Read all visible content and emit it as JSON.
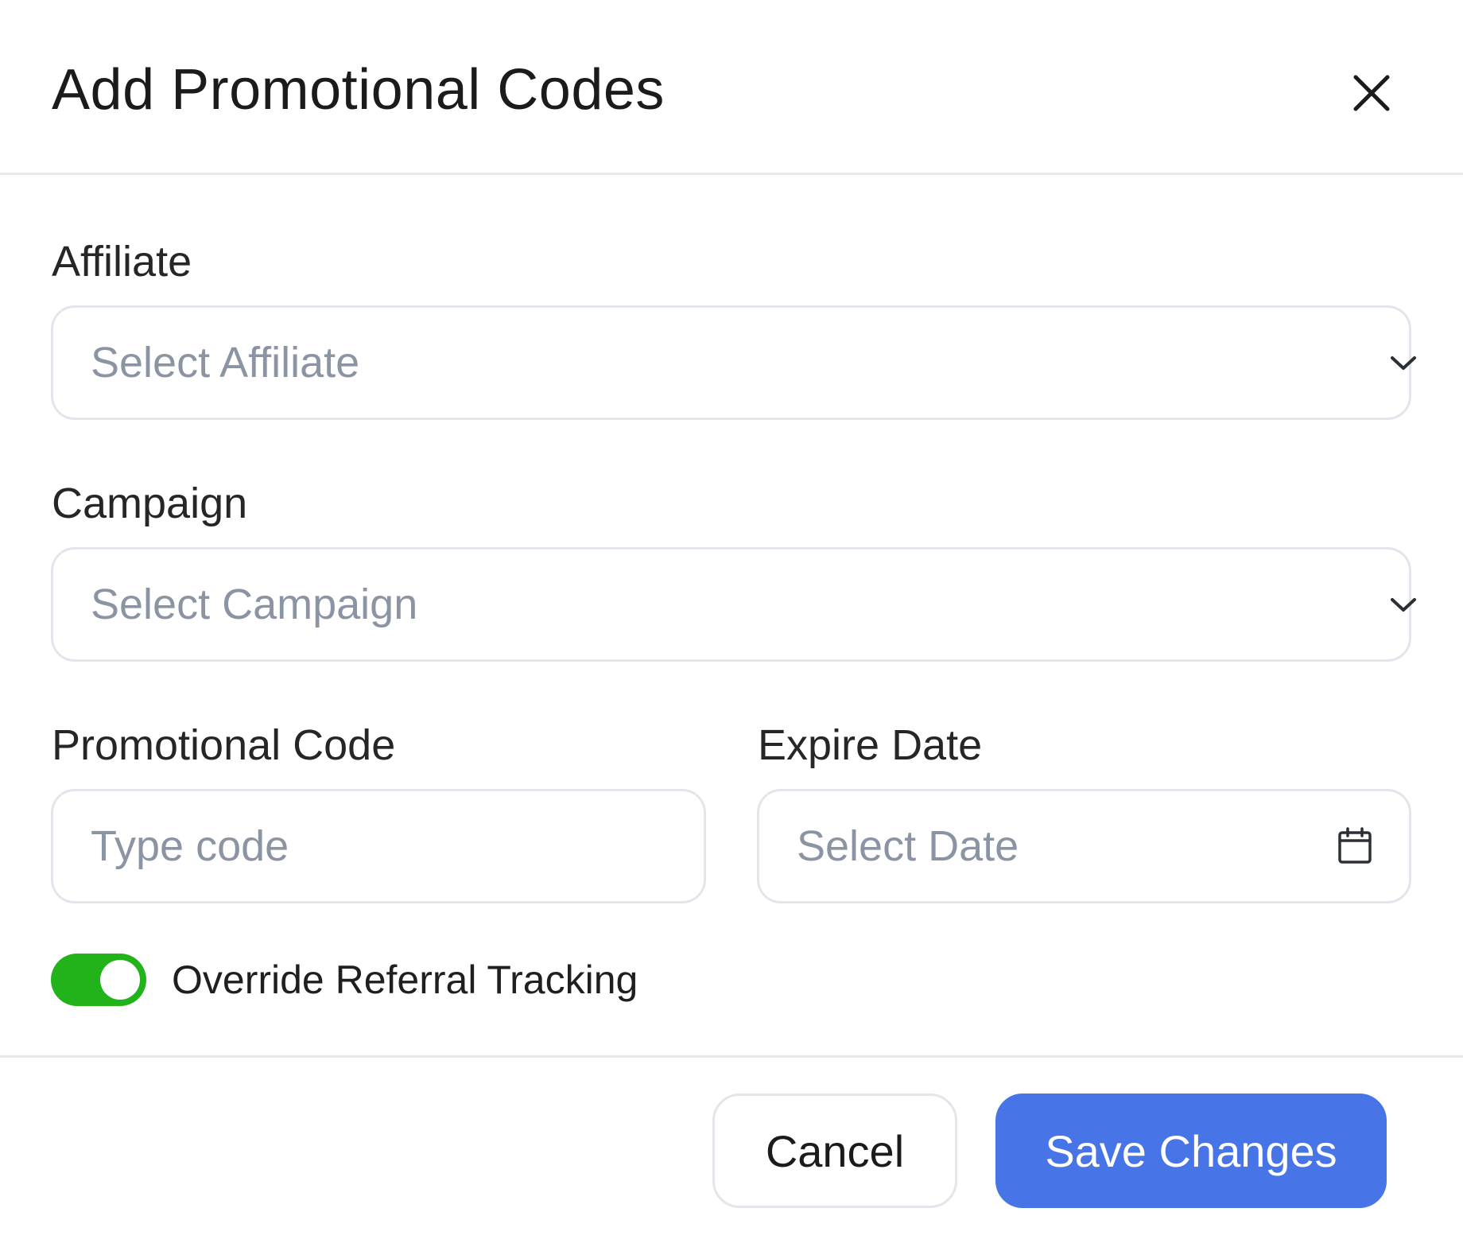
{
  "dialog": {
    "title": "Add Promotional Codes"
  },
  "form": {
    "affiliate": {
      "label": "Affiliate",
      "placeholder": "Select Affiliate"
    },
    "campaign": {
      "label": "Campaign",
      "placeholder": "Select Campaign"
    },
    "promo_code": {
      "label": "Promotional Code",
      "placeholder": "Type code"
    },
    "expire_date": {
      "label": "Expire Date",
      "placeholder": "Select Date"
    },
    "override_toggle": {
      "label": "Override Referral Tracking",
      "enabled": true
    }
  },
  "footer": {
    "cancel_label": "Cancel",
    "save_label": "Save Changes"
  },
  "icons": {
    "close": "close-icon",
    "affiliate_dropdown": "chevron-down-icon",
    "campaign_dropdown": "chevron-down-icon",
    "date": "calendar-icon"
  },
  "colors": {
    "primary": "#4774e6",
    "toggle_on": "#22b31a",
    "placeholder": "#8b94a3",
    "border": "#e2e5ea"
  }
}
